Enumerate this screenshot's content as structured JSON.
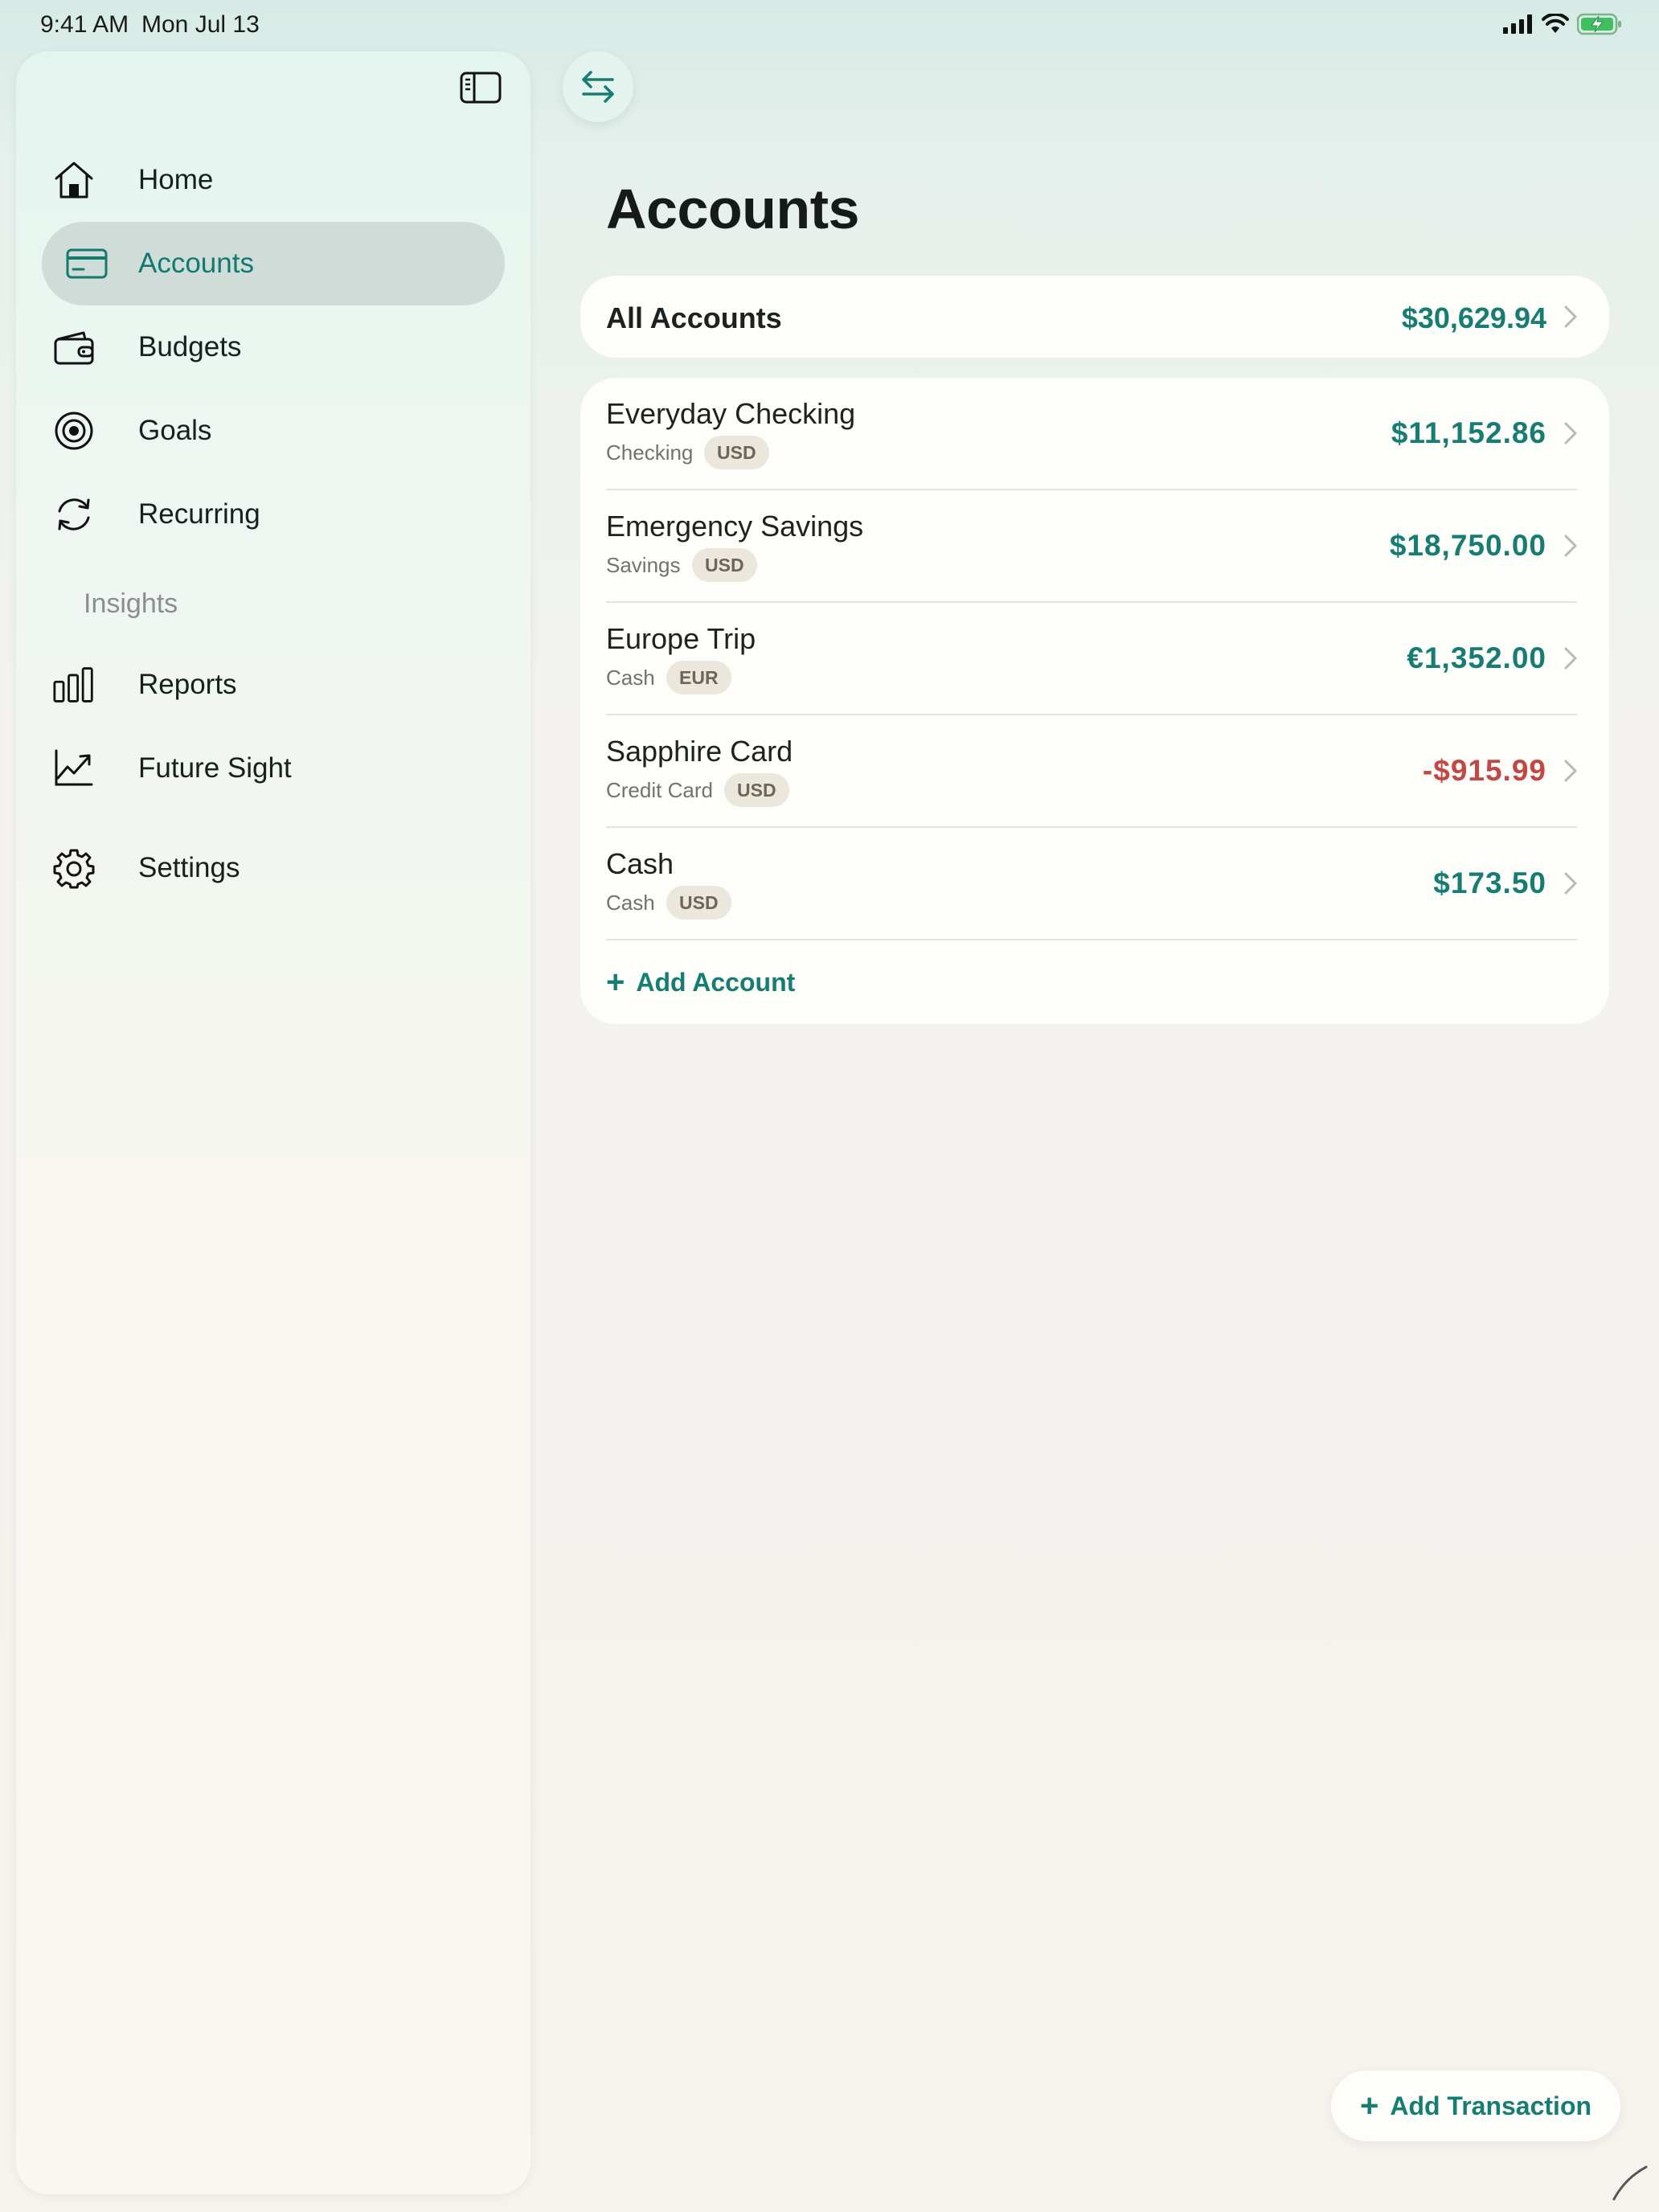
{
  "status_bar": {
    "time": "9:41 AM",
    "date": "Mon Jul 13"
  },
  "sidebar": {
    "items": [
      {
        "label": "Home",
        "icon": "house-icon"
      },
      {
        "label": "Accounts",
        "icon": "credit-card-icon",
        "active": true
      },
      {
        "label": "Budgets",
        "icon": "wallet-icon"
      },
      {
        "label": "Goals",
        "icon": "target-icon"
      },
      {
        "label": "Recurring",
        "icon": "refresh-icon"
      }
    ],
    "section_header": "Insights",
    "insights_items": [
      {
        "label": "Reports",
        "icon": "bar-chart-icon"
      },
      {
        "label": "Future Sight",
        "icon": "trend-chart-icon"
      }
    ],
    "settings": {
      "label": "Settings",
      "icon": "gear-icon"
    }
  },
  "main": {
    "title": "Accounts",
    "all_accounts": {
      "label": "All Accounts",
      "amount": "$30,629.94"
    },
    "accounts": [
      {
        "name": "Everyday Checking",
        "type": "Checking",
        "currency": "USD",
        "amount": "$11,152.86",
        "negative": false
      },
      {
        "name": "Emergency Savings",
        "type": "Savings",
        "currency": "USD",
        "amount": "$18,750.00",
        "negative": false
      },
      {
        "name": "Europe Trip",
        "type": "Cash",
        "currency": "EUR",
        "amount": "€1,352.00",
        "negative": false
      },
      {
        "name": "Sapphire Card",
        "type": "Credit Card",
        "currency": "USD",
        "amount": "-$915.99",
        "negative": true
      },
      {
        "name": "Cash",
        "type": "Cash",
        "currency": "USD",
        "amount": "$173.50",
        "negative": false
      }
    ],
    "add_account_label": "Add Account",
    "add_transaction_label": "Add Transaction"
  },
  "colors": {
    "accent": "#177d72",
    "negative": "#c24845",
    "active_nav_bg": "#cfdcd7"
  }
}
